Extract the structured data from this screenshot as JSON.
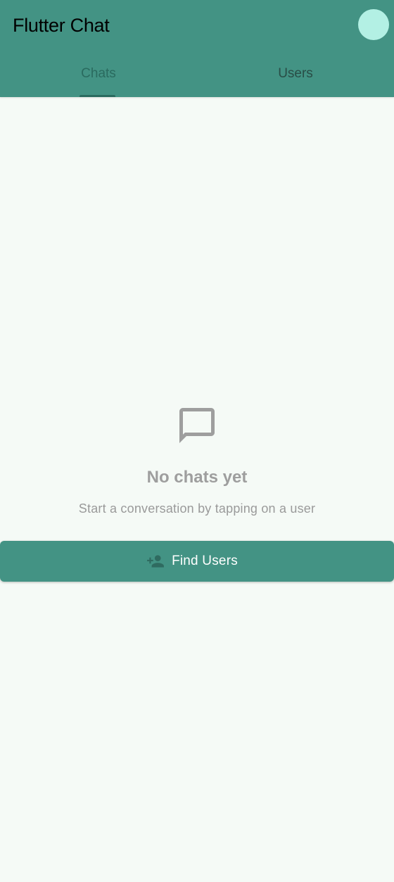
{
  "app": {
    "title": "Flutter Chat"
  },
  "tabs": [
    {
      "label": "Chats",
      "selected": true
    },
    {
      "label": "Users",
      "selected": false
    }
  ],
  "empty_state": {
    "icon": "chat-bubble-outline-icon",
    "title": "No chats yet",
    "subtitle": "Start a conversation by tapping on a user"
  },
  "action": {
    "icon": "person-add-icon",
    "label": "Find Users"
  },
  "colors": {
    "primary": "#439384",
    "background": "#f5faf6",
    "avatar": "#b3f0e4",
    "tab_selected": "#2a6b5f",
    "muted_text": "#9e9e9e"
  }
}
